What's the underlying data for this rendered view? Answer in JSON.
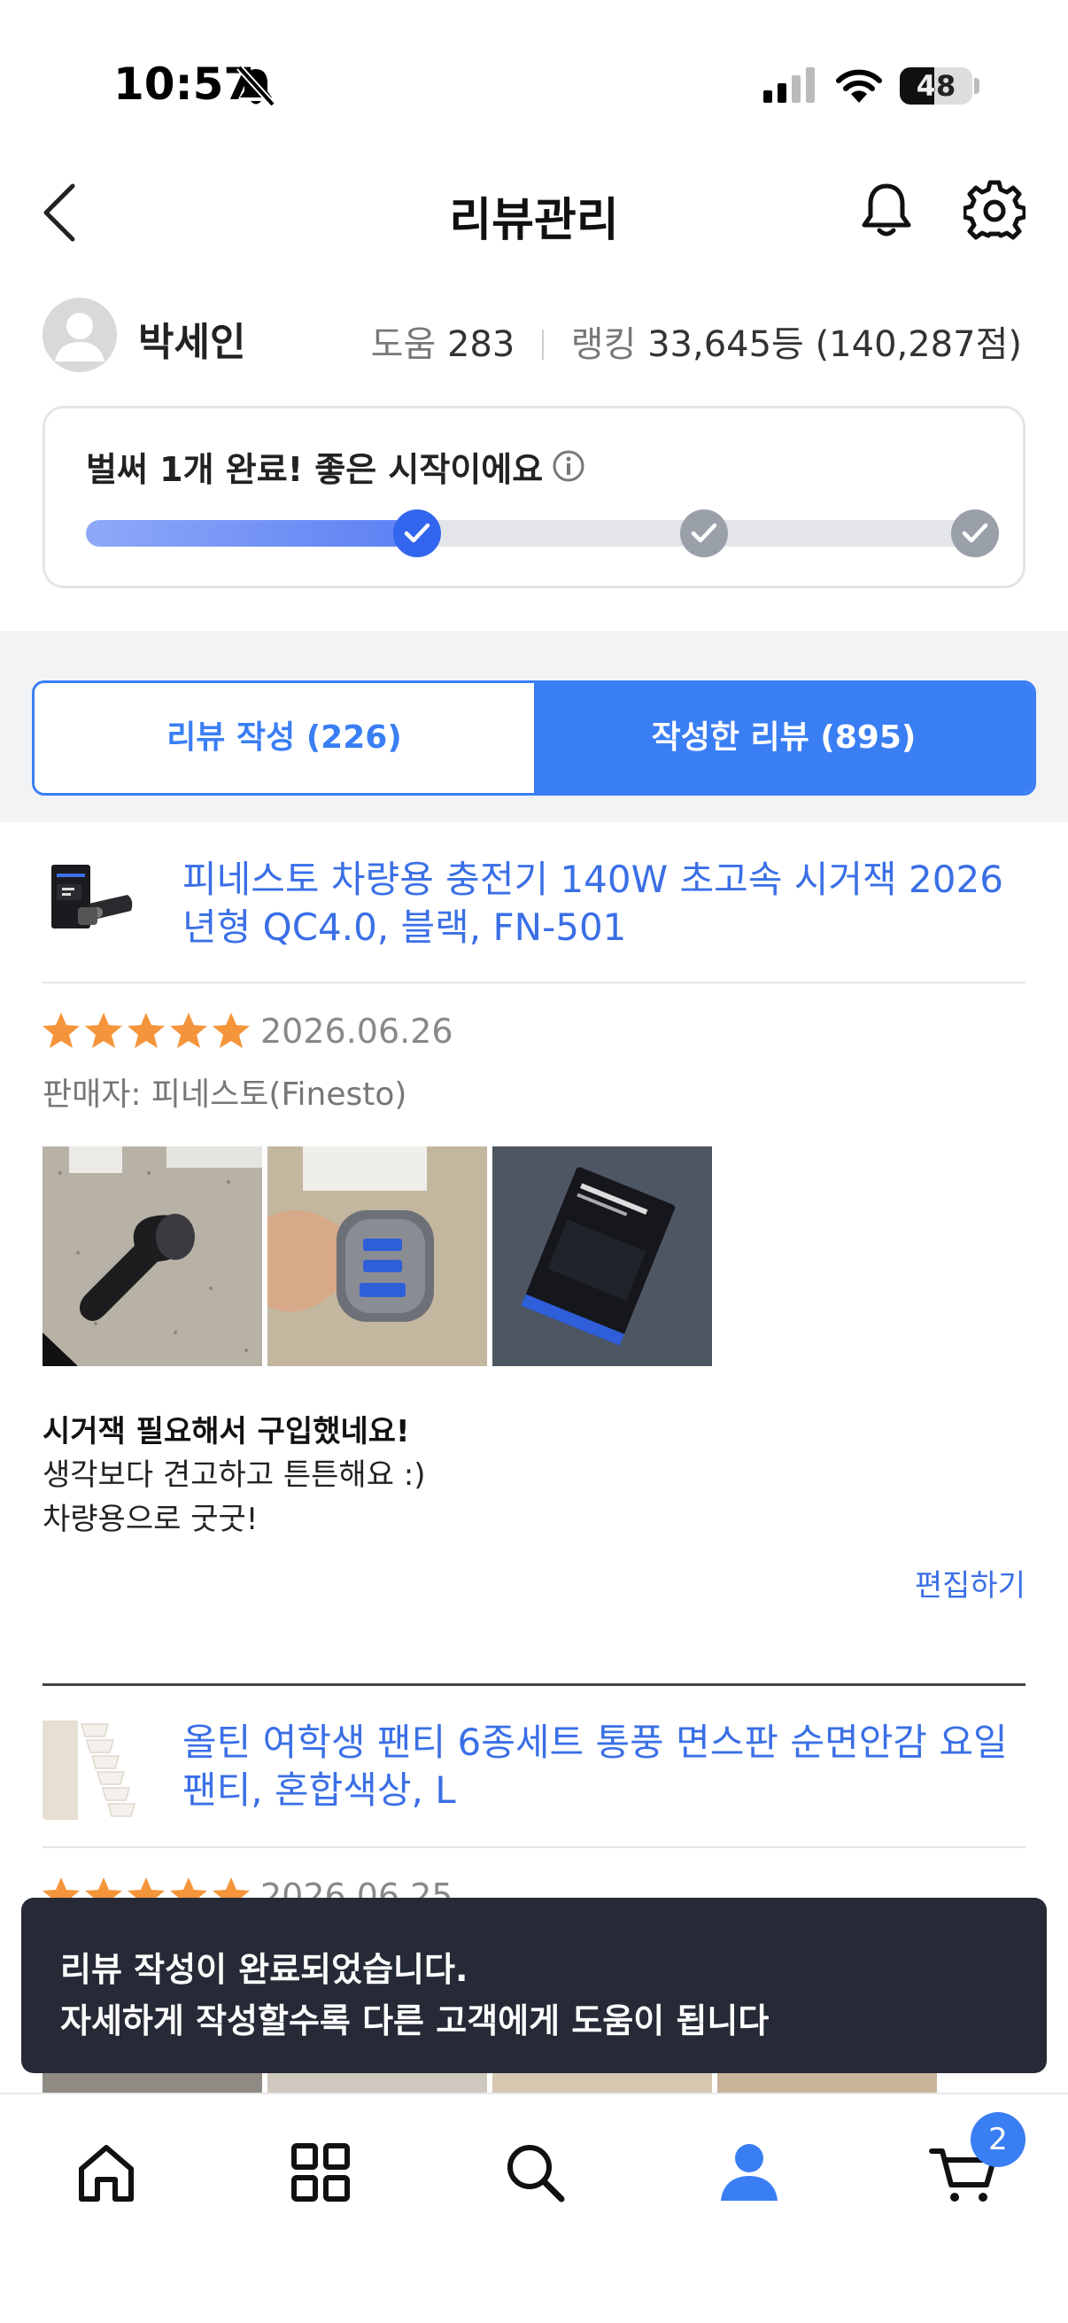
{
  "status_bar": {
    "time": "10:57",
    "battery": "48",
    "battery_level": 0.48
  },
  "header": {
    "title": "리뷰관리"
  },
  "profile": {
    "name": "박세인",
    "help_label": "도움",
    "help_count": "283",
    "ranking_label": "랭킹",
    "ranking_value": "33,645등 (140,287점)"
  },
  "progress": {
    "message": "벌써 1개 완료! 좋은 시작이에요",
    "completed_steps": 1,
    "total_steps": 3,
    "fill_fraction": 0.37
  },
  "tabs": [
    {
      "label": "리뷰 작성 (226)",
      "active": false
    },
    {
      "label": "작성한 리뷰 (895)",
      "active": true
    }
  ],
  "reviews": [
    {
      "product_title": "피네스토 차량용 충전기 140W 초고속 시거잭 2026년형 QC4.0, 블랙, FN-501",
      "rating": 5,
      "date": "2026.06.26",
      "seller": "판매자: 피네스토(Finesto)",
      "review_title": "시거잭 필요해서 구입했네요!",
      "review_body": "생각보다 견고하고 튼튼해요 :)\n차량용으로 굿굿!",
      "edit_label": "편집하기"
    },
    {
      "product_title": "올틴 여학생 팬티 6종세트 통풍 면스판 순면안감 요일팬티, 혼합색상, L",
      "rating": 5,
      "date": "2026.06.25"
    }
  ],
  "toast": {
    "line1": "리뷰 작성이 완료되었습니다.",
    "line2": "자세하게 작성할수록 다른 고객에게 도움이 됩니다"
  },
  "bottom_nav": {
    "items": [
      "home-icon",
      "categories-icon",
      "search-icon",
      "profile-icon",
      "cart-icon"
    ],
    "cart_count": "2"
  },
  "colors": {
    "accent": "#3a7ef4",
    "star": "#f5953b",
    "toast_bg": "#252a36"
  }
}
